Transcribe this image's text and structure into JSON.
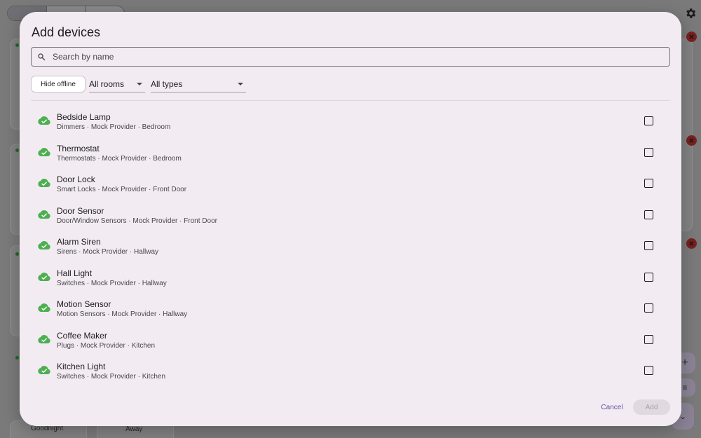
{
  "background": {
    "scene_labels": [
      "Goodnight",
      "Away"
    ]
  },
  "dialog": {
    "title": "Add devices",
    "search": {
      "placeholder": "Search by name",
      "value": ""
    },
    "filters": {
      "hide_offline_label": "Hide offline",
      "rooms_value": "All rooms",
      "types_value": "All types"
    },
    "devices": [
      {
        "name": "Bedside Lamp",
        "meta": "Dimmers · Mock Provider · Bedroom",
        "status": "online",
        "checked": false
      },
      {
        "name": "Thermostat",
        "meta": "Thermostats · Mock Provider · Bedroom",
        "status": "online",
        "checked": false
      },
      {
        "name": "Door Lock",
        "meta": "Smart Locks · Mock Provider · Front Door",
        "status": "online",
        "checked": false
      },
      {
        "name": "Door Sensor",
        "meta": "Door/Window Sensors · Mock Provider · Front Door",
        "status": "online",
        "checked": false
      },
      {
        "name": "Alarm Siren",
        "meta": "Sirens · Mock Provider · Hallway",
        "status": "online",
        "checked": false
      },
      {
        "name": "Hall Light",
        "meta": "Switches · Mock Provider · Hallway",
        "status": "online",
        "checked": false
      },
      {
        "name": "Motion Sensor",
        "meta": "Motion Sensors · Mock Provider · Hallway",
        "status": "online",
        "checked": false
      },
      {
        "name": "Coffee Maker",
        "meta": "Plugs · Mock Provider · Kitchen",
        "status": "online",
        "checked": false
      },
      {
        "name": "Kitchen Light",
        "meta": "Switches · Mock Provider · Kitchen",
        "status": "online",
        "checked": false
      }
    ],
    "actions": {
      "cancel_label": "Cancel",
      "add_label": "Add"
    }
  },
  "colors": {
    "online": "#4caf50",
    "accent": "#6750a4",
    "dialog_bg": "#f2ebf2"
  },
  "icons": {
    "status": "cloud-check-icon",
    "search": "search-icon",
    "settings": "gear-icon",
    "remove": "close-circle-icon"
  }
}
